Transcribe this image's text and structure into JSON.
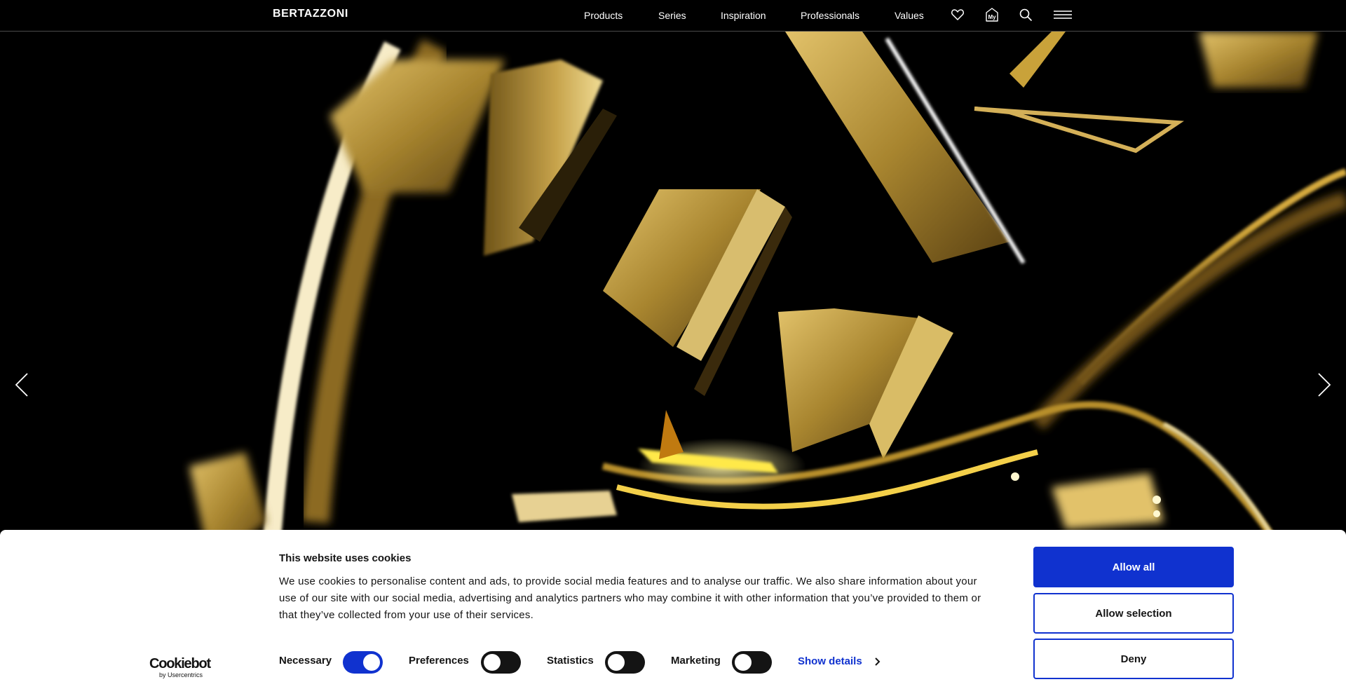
{
  "header": {
    "logo": "BERTAZZONI",
    "nav": [
      {
        "label": "Products"
      },
      {
        "label": "Series"
      },
      {
        "label": "Inspiration"
      },
      {
        "label": "Professionals"
      },
      {
        "label": "Values"
      }
    ],
    "icons": [
      "heart-icon",
      "my-account-icon",
      "search-icon",
      "menu-icon"
    ],
    "my_badge": "My"
  },
  "hero": {
    "background_color": "#000000",
    "accent_color": "#c9a23a",
    "prev_icon": "chevron-left-icon",
    "next_icon": "chevron-right-icon"
  },
  "cookie_banner": {
    "brand": "Cookiebot",
    "brand_sub": "by Usercentrics",
    "title": "This website uses cookies",
    "text": "We use cookies to personalise content and ads, to provide social media features and to analyse our traffic. We also share information about your use of our site with our social media, advertising and analytics partners who may combine it with other information that you’ve provided to them or that they’ve collected from your use of their services.",
    "consents": [
      {
        "label": "Necessary",
        "checked": true
      },
      {
        "label": "Preferences",
        "checked": false
      },
      {
        "label": "Statistics",
        "checked": false
      },
      {
        "label": "Marketing",
        "checked": false
      }
    ],
    "show_details": "Show details",
    "buttons": {
      "allow_all": "Allow all",
      "allow_selection": "Allow selection",
      "deny": "Deny"
    },
    "accent_color": "#1032cf"
  }
}
